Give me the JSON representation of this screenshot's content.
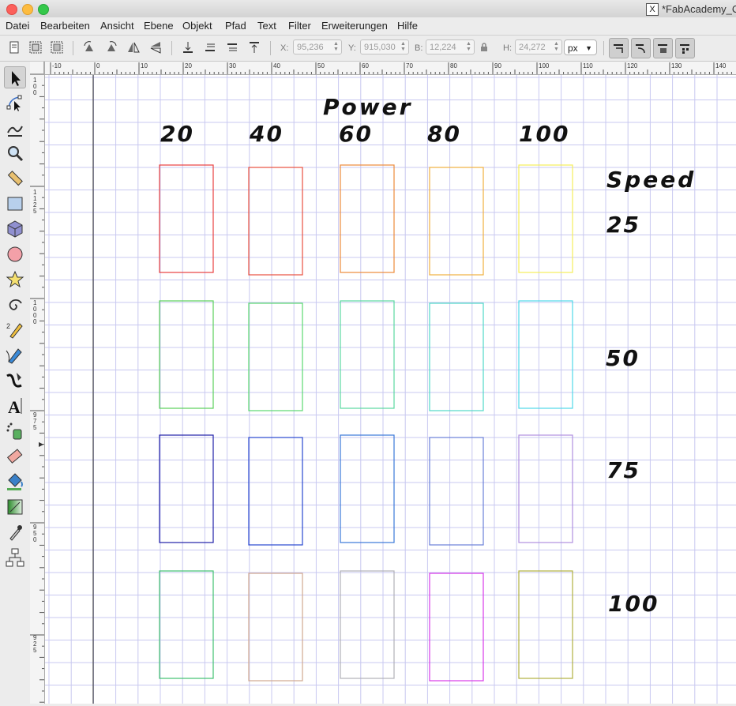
{
  "window": {
    "title": "*FabAcademy_C",
    "x_logo": "X"
  },
  "menu": [
    "Datei",
    "Bearbeiten",
    "Ansicht",
    "Ebene",
    "Objekt",
    "Pfad",
    "Text",
    "Filter",
    "Erweiterungen",
    "Hilfe"
  ],
  "toolbar": {
    "x_label": "X:",
    "x_value": "95,236",
    "y_label": "Y:",
    "y_value": "915,030",
    "w_label": "B:",
    "w_value": "12,224",
    "h_label": "H:",
    "h_value": "24,272",
    "unit": "px"
  },
  "ruler": {
    "h_labels": [
      "-10",
      "0",
      "10",
      "20",
      "30",
      "40",
      "50",
      "60",
      "70",
      "80",
      "90",
      "100",
      "110",
      "120",
      "130",
      "140"
    ],
    "v_labels": [
      "1 0 0",
      "1 1 2 5",
      "1 0 0 0",
      "9 7 5",
      "9 5 0",
      "9 2 5"
    ]
  },
  "drawing": {
    "power_title": "Power",
    "power_values": [
      "20",
      "40",
      "60",
      "80",
      "100"
    ],
    "speed_title": "Speed",
    "speed_values": [
      "25",
      "50",
      "75",
      "100"
    ],
    "grid_colors": [
      [
        "#e8403f",
        "#e8503f",
        "#ec8a3a",
        "#f0b040",
        "#f5ee5a"
      ],
      [
        "#5ad05a",
        "#5ad870",
        "#5ad8a0",
        "#50d8c8",
        "#50d8e8"
      ],
      [
        "#2020a8",
        "#2848d0",
        "#3a78d8",
        "#6a80d8",
        "#b090e0"
      ],
      [
        "#40c070",
        "#d0a890",
        "#b0b0b8",
        "#d838e8",
        "#b0b040"
      ]
    ]
  }
}
